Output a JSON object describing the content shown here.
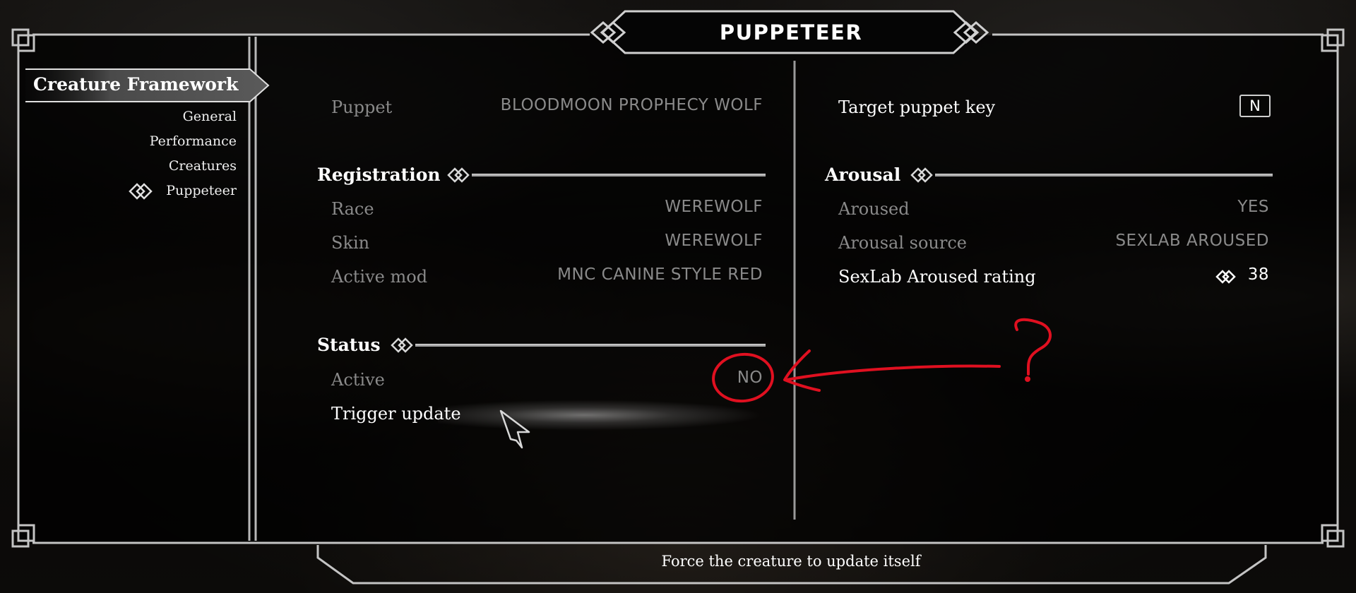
{
  "window": {
    "title": "PUPPETEER"
  },
  "sidebar": {
    "header": "Creature Framework",
    "items": [
      {
        "label": "General",
        "selected": false
      },
      {
        "label": "Performance",
        "selected": false
      },
      {
        "label": "Creatures",
        "selected": false
      },
      {
        "label": "Puppeteer",
        "selected": true
      }
    ]
  },
  "left_column": {
    "puppet": {
      "label": "Puppet",
      "value": "BLOODMOON PROPHECY WOLF"
    },
    "registration": {
      "header": "Registration",
      "rows": [
        {
          "label": "Race",
          "value": "WEREWOLF"
        },
        {
          "label": "Skin",
          "value": "WEREWOLF"
        },
        {
          "label": "Active mod",
          "value": "MNC CANINE STYLE RED"
        }
      ]
    },
    "status": {
      "header": "Status",
      "active": {
        "label": "Active",
        "value": "NO"
      },
      "trigger_update": {
        "label": "Trigger update"
      }
    }
  },
  "right_column": {
    "target_key": {
      "label": "Target puppet key",
      "key": "N"
    },
    "arousal": {
      "header": "Arousal",
      "rows": [
        {
          "label": "Aroused",
          "value": "YES"
        },
        {
          "label": "Arousal source",
          "value": "SEXLAB AROUSED"
        }
      ],
      "rating": {
        "label": "SexLab Aroused rating",
        "value": "38"
      }
    }
  },
  "annotation": {
    "question_mark": "?",
    "color": "#e01020"
  },
  "footer": {
    "info_text": "Force the creature to update itself"
  }
}
